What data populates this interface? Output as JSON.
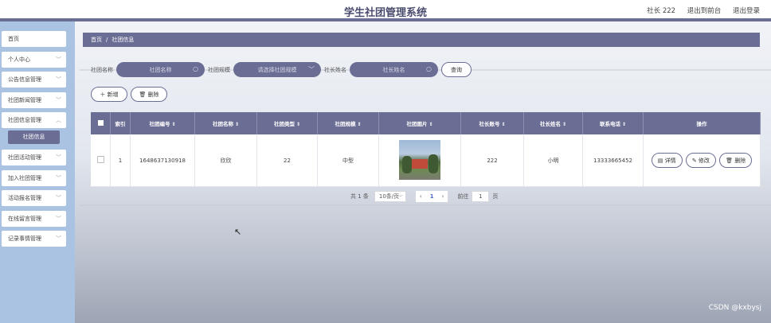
{
  "header": {
    "title": "学生社团管理系统",
    "user": "社长 222",
    "back_front": "退出到前台",
    "logout": "退出登录"
  },
  "sidebar": {
    "items": [
      {
        "label": "首页"
      },
      {
        "label": "个人中心",
        "icon": "chevron-down-icon"
      },
      {
        "label": "公告信息管理",
        "icon": "chevron-down-icon"
      },
      {
        "label": "社团新闻管理",
        "icon": "chevron-down-icon"
      },
      {
        "label": "社团信息管理",
        "icon": "chevron-up-icon"
      },
      {
        "label": "社团活动管理",
        "icon": "chevron-down-icon"
      },
      {
        "label": "加入社团管理",
        "icon": "chevron-down-icon"
      },
      {
        "label": "活动报名管理",
        "icon": "chevron-down-icon"
      },
      {
        "label": "在线留言管理",
        "icon": "chevron-down-icon"
      },
      {
        "label": "记录事情管理",
        "icon": "chevron-down-icon"
      }
    ],
    "active_sub": "社团信息"
  },
  "breadcrumb": {
    "home": "首页",
    "separator": "/",
    "current": "社团信息"
  },
  "search": {
    "club_name_label": "社团名称",
    "club_name_placeholder": "社团名称",
    "scale_label": "社团规模",
    "scale_placeholder": "请选择社团规模",
    "leader_label": "社长姓名",
    "leader_placeholder": "社长姓名",
    "query_button": "查询"
  },
  "actions": {
    "add_label": "新增",
    "delete_label": "删除"
  },
  "table": {
    "headers": [
      "索引",
      "社团编号",
      "社团名称",
      "社团类型",
      "社团规模",
      "社团图片",
      "社长账号",
      "社长姓名",
      "联系电话",
      "操作"
    ],
    "rows": [
      {
        "index": "1",
        "club_id": "1648637130918",
        "name": "欣欣",
        "type": "22",
        "scale": "中型",
        "leader_account": "222",
        "leader_name": "小明",
        "phone": "13333665452"
      }
    ],
    "row_actions": {
      "detail": "详情",
      "edit": "修改",
      "delete": "删除"
    }
  },
  "pagination": {
    "total": "共 1 条",
    "page_size": "10条/页",
    "current_page": "1",
    "goto_label": "前往",
    "goto_value": "1",
    "page_unit": "页"
  },
  "watermark": "CSDN @kxbysj",
  "colors": {
    "primary": "#6b6e94",
    "sidebar_bg": "#aac3e3"
  }
}
